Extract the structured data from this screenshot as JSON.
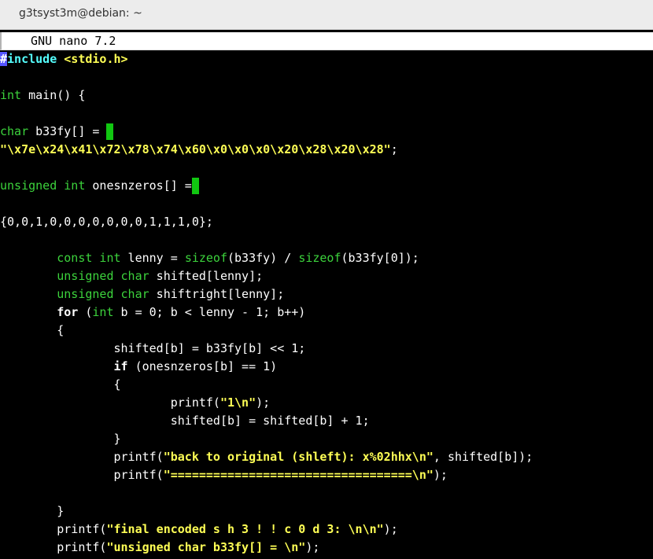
{
  "window": {
    "title": "g3tsyst3m@debian: ~"
  },
  "nano": {
    "version": "  GNU nano 7.2"
  },
  "code": {
    "l1": {
      "hash": "#",
      "directive": "include",
      "sp": " ",
      "header": "<stdio.h>"
    },
    "l3": {
      "type": "int",
      "rest": " main() {"
    },
    "l5": {
      "type": "char",
      "rest": " b33fy[] ="
    },
    "l6": {
      "string": "\"\\x7e\\x24\\x41\\x72\\x78\\x74\\x60\\x0\\x0\\x0\\x20\\x28\\x20\\x28\"",
      "rest": ";"
    },
    "l8": {
      "type": "unsigned int",
      "rest": " onesnzeros[] ="
    },
    "l10": {
      "text": "{0,0,1,0,0,0,0,0,0,0,1,1,1,0};"
    },
    "l12": {
      "indent": "        ",
      "type": "const int",
      "mid": " lenny = ",
      "kw1": "sizeof",
      "mid2": "(b33fy) / ",
      "kw2": "sizeof",
      "rest": "(b33fy[0]);"
    },
    "l13": {
      "indent": "        ",
      "type": "unsigned char",
      "rest": " shifted[lenny];"
    },
    "l14": {
      "indent": "        ",
      "type": "unsigned char",
      "rest": " shiftright[lenny];"
    },
    "l15": {
      "indent": "        ",
      "kw": "for",
      "mid": " (",
      "type": "int",
      "rest": " b = 0; b < lenny - 1; b++)"
    },
    "l16": {
      "text": "        {"
    },
    "l17": {
      "text": "                shifted[b] = b33fy[b] << 1;"
    },
    "l18": {
      "indent": "                ",
      "kw": "if",
      "rest": " (onesnzeros[b] == 1)"
    },
    "l19": {
      "text": "                {"
    },
    "l20": {
      "indent": "                        ",
      "pre": "printf(",
      "string": "\"1\\n\"",
      "rest": ");"
    },
    "l21": {
      "text": "                        shifted[b] = shifted[b] + 1;"
    },
    "l22": {
      "text": "                }"
    },
    "l23": {
      "indent": "                ",
      "pre": "printf(",
      "string": "\"back to original (shleft): x%02hhx\\n\"",
      "rest": ", shifted[b]);"
    },
    "l24": {
      "indent": "                ",
      "pre": "printf(",
      "string": "\"==================================\\n\"",
      "rest": ");"
    },
    "l26": {
      "text": "        }"
    },
    "l27": {
      "indent": "        ",
      "pre": "printf(",
      "string": "\"final encoded s h 3 ! ! c 0 d 3: \\n\\n\"",
      "rest": ");"
    },
    "l28": {
      "indent": "        ",
      "pre": "printf(",
      "string": "\"unsigned char b33fy[] = \\n\"",
      "rest": ");"
    }
  }
}
